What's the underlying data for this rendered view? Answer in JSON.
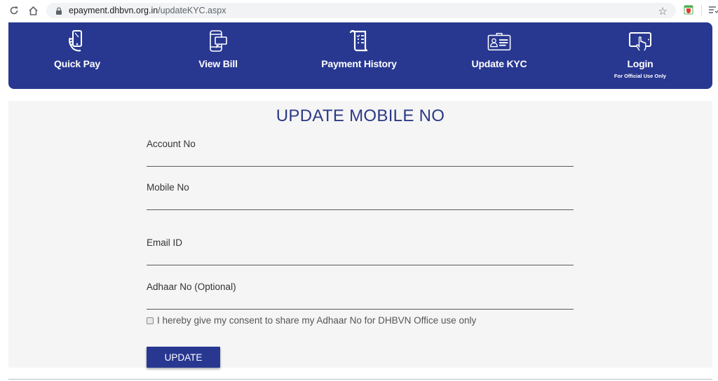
{
  "browser": {
    "url_domain": "epayment.dhbvn.org.in",
    "url_path": "/updateKYC.aspx"
  },
  "nav": {
    "items": [
      {
        "label": "Quick Pay",
        "icon": "hand-phone-icon"
      },
      {
        "label": "View Bill",
        "icon": "phone-message-icon"
      },
      {
        "label": "Payment History",
        "icon": "receipt-scroll-icon"
      },
      {
        "label": "Update KYC",
        "icon": "id-card-icon"
      },
      {
        "label": "Login",
        "sublabel": "For Official Use Only",
        "icon": "tablet-touch-icon"
      }
    ]
  },
  "form": {
    "title": "UPDATE MOBILE NO",
    "fields": [
      {
        "label": "Account No",
        "value": ""
      },
      {
        "label": "Mobile No",
        "value": ""
      },
      {
        "label": "Email ID",
        "value": ""
      },
      {
        "label": "Adhaar No (Optional)",
        "value": ""
      }
    ],
    "consent_text": "I hereby give my consent to share my Adhaar No for DHBVN Office use only",
    "consent_checked": false,
    "submit_label": "UPDATE"
  },
  "colors": {
    "brand": "#283891",
    "title": "#2b3a86",
    "panel_bg": "#f5f5f5"
  }
}
